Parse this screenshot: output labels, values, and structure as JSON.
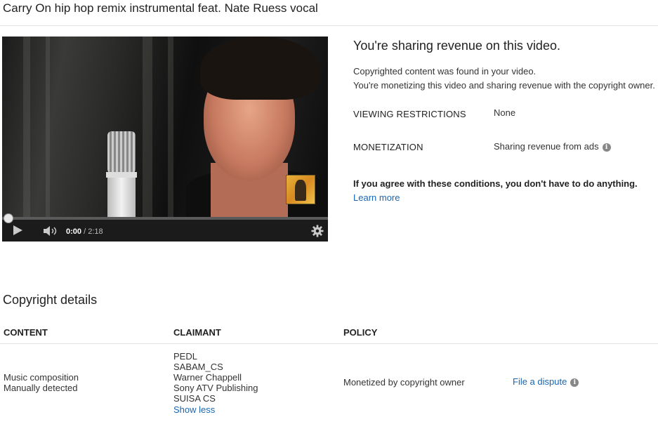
{
  "page": {
    "title": "Carry On hip hop remix instrumental feat. Nate Ruess vocal"
  },
  "player": {
    "time_current": "0:00",
    "time_separator": " / ",
    "time_total": "2:18",
    "progress_fraction": 0.0
  },
  "status": {
    "title": "You're sharing revenue on this video.",
    "line1": "Copyrighted content was found in your video.",
    "line2": "You're monetizing this video and sharing revenue with the copyright owner.",
    "viewing_label": "VIEWING RESTRICTIONS",
    "viewing_value": "None",
    "monetization_label": "MONETIZATION",
    "monetization_value": "Sharing revenue from ads",
    "agree_text": "If you agree with these conditions, you don't have to do anything.",
    "learn_more": "Learn more"
  },
  "copyright": {
    "title": "Copyright details",
    "headers": {
      "content": "CONTENT",
      "claimant": "CLAIMANT",
      "policy": "POLICY"
    },
    "row": {
      "content": [
        "Music composition",
        "Manually detected"
      ],
      "claimants": [
        "PEDL",
        "SABAM_CS",
        "Warner Chappell",
        "Sony ATV Publishing",
        "SUISA CS"
      ],
      "show_less": "Show less",
      "policy": "Monetized by copyright owner",
      "action": "File a dispute"
    }
  },
  "colors": {
    "link": "#1a66b0",
    "progress": "#cc0000",
    "info_icon": "#888888"
  },
  "icons": {
    "play": "play-icon",
    "volume": "volume-icon",
    "settings": "gear-icon",
    "info": "info-icon"
  }
}
